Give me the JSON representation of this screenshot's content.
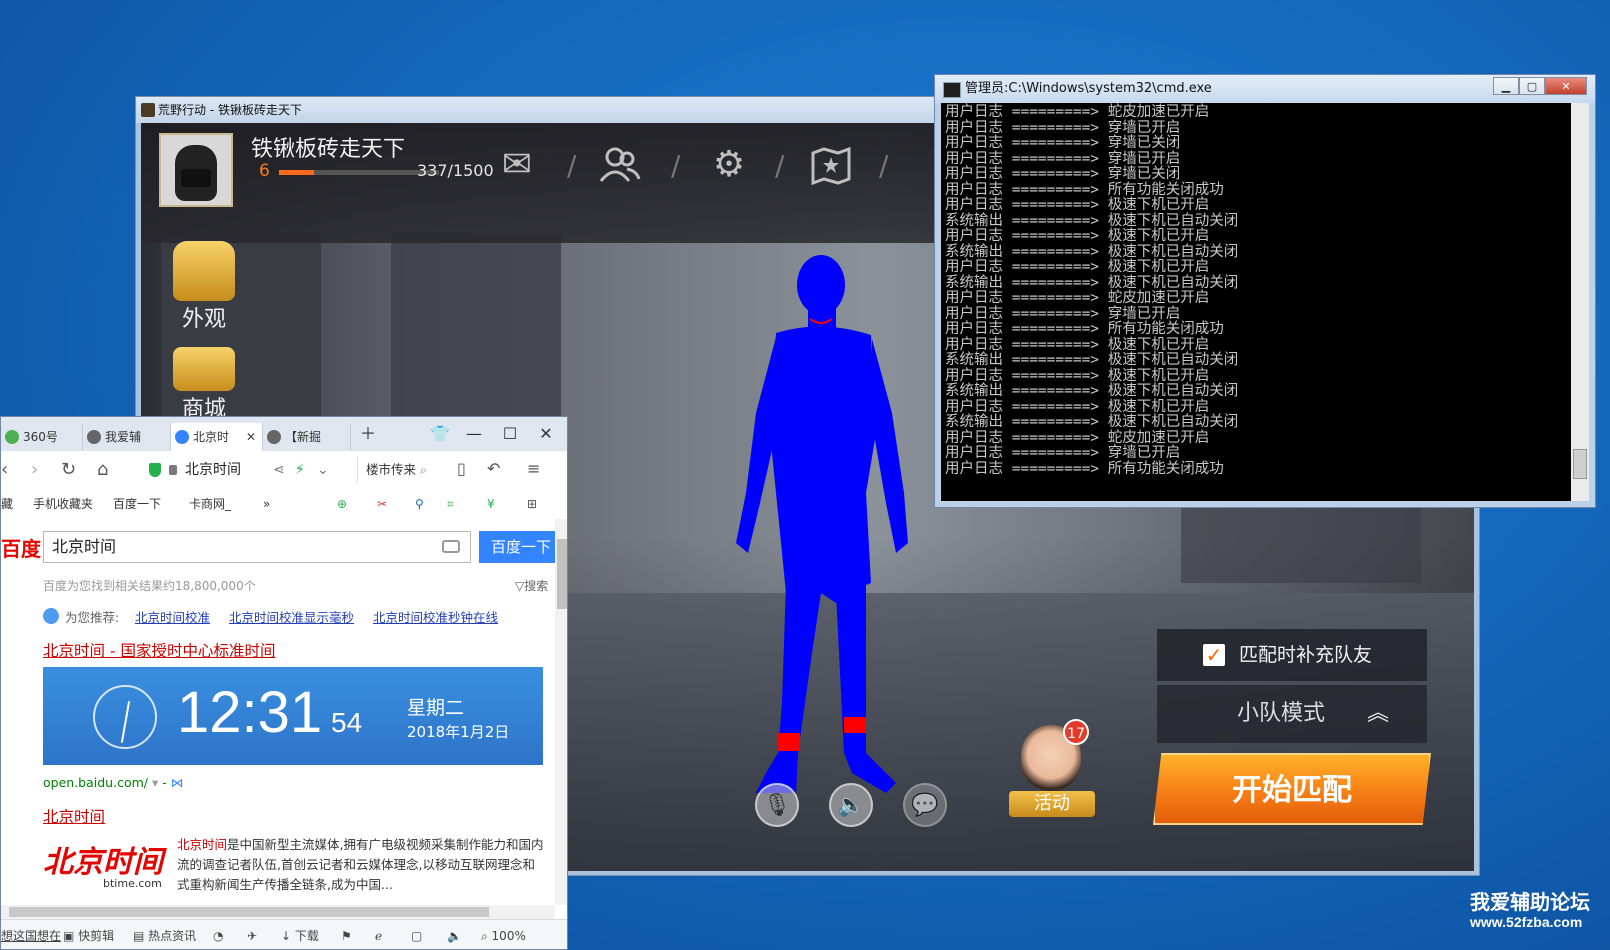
{
  "game_window": {
    "title": "荒野行动 - 铁锹板砖走天下",
    "player": {
      "name": "铁锹板砖走天下",
      "level": "6",
      "exp": "337/1500",
      "exp_fraction": 0.22
    },
    "top_icons": [
      "mail-icon",
      "friends-icon",
      "gear-icon",
      "map-icon"
    ],
    "side_menu": [
      {
        "label": "外观",
        "icon": "hood-icon"
      },
      {
        "label": "商城",
        "icon": "chest-icon"
      }
    ],
    "fill_team": {
      "label": "匹配时补充队友",
      "checked": true
    },
    "mode": {
      "label": "小队模式"
    },
    "start_button": "开始匹配",
    "activity": {
      "label": "活动",
      "badge": "17"
    },
    "bottom_icons": [
      "microphone-icon",
      "speaker-icon",
      "chat-icon"
    ],
    "colors": {
      "character": "#0000ff",
      "accent": "#f57b14"
    }
  },
  "cmd_window": {
    "title": "管理员:C:\\Windows\\system32\\cmd.exe",
    "controls": [
      "minimize",
      "maximize",
      "close"
    ],
    "lines": [
      "用户日志 =========> 蛇皮加速已开启",
      "用户日志 =========> 穿墙已开启",
      "用户日志 =========> 穿墙已关闭",
      "用户日志 =========> 穿墙已开启",
      "用户日志 =========> 穿墙已关闭",
      "用户日志 =========> 所有功能关闭成功",
      "用户日志 =========> 极速下机已开启",
      "系统输出 =========> 极速下机已自动关闭",
      "用户日志 =========> 极速下机已开启",
      "系统输出 =========> 极速下机已自动关闭",
      "用户日志 =========> 极速下机已开启",
      "系统输出 =========> 极速下机已自动关闭",
      "用户日志 =========> 蛇皮加速已开启",
      "用户日志 =========> 穿墙已开启",
      "用户日志 =========> 所有功能关闭成功",
      "用户日志 =========> 极速下机已开启",
      "系统输出 =========> 极速下机已自动关闭",
      "用户日志 =========> 极速下机已开启",
      "系统输出 =========> 极速下机已自动关闭",
      "用户日志 =========> 极速下机已开启",
      "系统输出 =========> 极速下机已自动关闭",
      "用户日志 =========> 蛇皮加速已开启",
      "用户日志 =========> 穿墙已开启",
      "用户日志 =========> 所有功能关闭成功"
    ]
  },
  "browser": {
    "tabs": [
      "360号",
      "我爱辅",
      "北京时",
      "【新掘"
    ],
    "active_tab": 2,
    "address": "北京时间",
    "nav_search": "楼市传来",
    "bookmarks": [
      "藏",
      "手机收藏夹",
      "百度一下",
      "卡商网_",
      "»"
    ],
    "baidu": {
      "logo": "百度",
      "query": "北京时间",
      "search_button": "百度一下",
      "result_count": "百度为您找到相关结果约18,800,000个",
      "filter": "搜索",
      "recommend_label": "为您推荐:",
      "recommendations": [
        "北京时间校准",
        "北京时间校准显示毫秒",
        "北京时间校准秒钟在线"
      ],
      "result1_title": "北京时间 - 国家授时中心标准时间",
      "time": "12:31",
      "seconds": "54",
      "weekday": "星期二",
      "date": "2018年1月2日",
      "url": "open.baidu.com/",
      "url_extra": "-",
      "result2_title": "北京时间",
      "btime_logo": "北京时间",
      "btime_sub": "btime.com",
      "desc_highlight": "北京时间",
      "desc": "是中国新型主流媒体,拥有广电级视频采集制作能力和国内 流的调查记者队伍,首创云记者和云媒体理念,以移动互联网理念和 式重构新闻生产传播全链条,成为中国..."
    },
    "status": [
      "想这国想在",
      "快剪辑",
      "热点资讯",
      "下载",
      "100%"
    ]
  },
  "watermark": {
    "line1": "我爱辅助论坛",
    "line2": "www.52fzba.com"
  }
}
